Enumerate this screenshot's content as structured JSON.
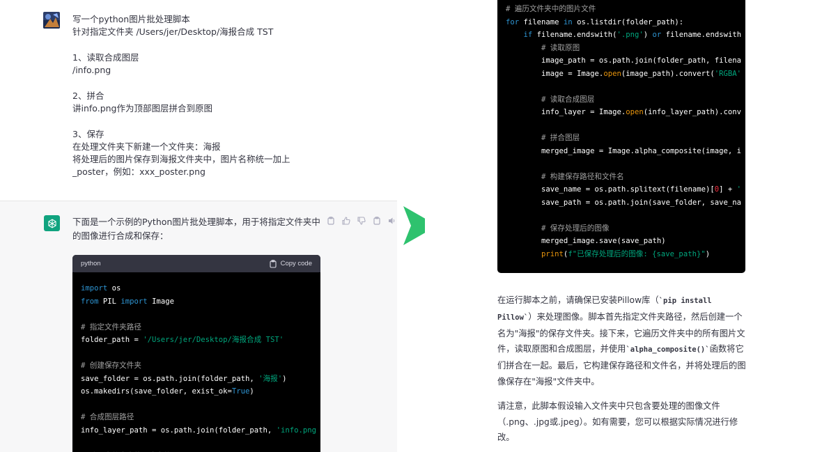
{
  "user_message": {
    "lines": [
      "写一个python图片批处理脚本",
      "针对指定文件夹 /Users/jer/Desktop/海报合成 TST",
      "",
      "1、读取合成图层",
      "/info.png",
      "",
      "2、拼合",
      "讲info.png作为顶部图层拼合到原图",
      "",
      "3、保存",
      "在处理文件夹下新建一个文件夹：海报",
      "将处理后的图片保存到海报文件夹中，图片名称统一加上",
      "_poster，例如：xxx_poster.png"
    ]
  },
  "assistant_message": {
    "intro": "下面是一个示例的Python图片批处理脚本，用于将指定文件夹中的图像进行合成和保存：",
    "code_language": "python",
    "copy_label": "Copy code"
  },
  "code_left_lines": [
    [
      {
        "t": "import",
        "c": "kw"
      },
      {
        "t": " os"
      }
    ],
    [
      {
        "t": "from",
        "c": "kw"
      },
      {
        "t": " PIL "
      },
      {
        "t": "import",
        "c": "kw"
      },
      {
        "t": " Image"
      }
    ],
    [],
    [
      {
        "t": "# 指定文件夹路径",
        "c": "cm"
      }
    ],
    [
      {
        "t": "folder_path = "
      },
      {
        "t": "'/Users/jer/Desktop/海报合成 TST'",
        "c": "str"
      }
    ],
    [],
    [
      {
        "t": "# 创建保存文件夹",
        "c": "cm"
      }
    ],
    [
      {
        "t": "save_folder = os.path.join(folder_path, "
      },
      {
        "t": "'海报'",
        "c": "str"
      },
      {
        "t": ")"
      }
    ],
    [
      {
        "t": "os.makedirs(save_folder, exist_ok="
      },
      {
        "t": "True",
        "c": "kw"
      },
      {
        "t": ")"
      }
    ],
    [],
    [
      {
        "t": "# 合成图层路径",
        "c": "cm"
      }
    ],
    [
      {
        "t": "info_layer_path = os.path.join(folder_path, "
      },
      {
        "t": "'info.png",
        "c": "str"
      }
    ],
    [],
    [
      {
        "t": "# 遍历文件夹中的图片文件",
        "c": "cm"
      }
    ]
  ],
  "code_right_lines": [
    [
      {
        "t": "# 遍历文件夹中的图片文件",
        "c": "cm"
      }
    ],
    [
      {
        "t": "for",
        "c": "kw"
      },
      {
        "t": " filename "
      },
      {
        "t": "in",
        "c": "kw"
      },
      {
        "t": " os.listdir(folder_path):"
      }
    ],
    [
      {
        "t": "    "
      },
      {
        "t": "if",
        "c": "kw"
      },
      {
        "t": " filename.endswith("
      },
      {
        "t": "'.png'",
        "c": "str"
      },
      {
        "t": ") "
      },
      {
        "t": "or",
        "c": "kw"
      },
      {
        "t": " filename.endswith"
      }
    ],
    [
      {
        "t": "        "
      },
      {
        "t": "# 读取原图",
        "c": "cm"
      }
    ],
    [
      {
        "t": "        image_path = os.path.join(folder_path, filena"
      }
    ],
    [
      {
        "t": "        image = Image."
      },
      {
        "t": "open",
        "c": "builtin"
      },
      {
        "t": "(image_path).convert("
      },
      {
        "t": "'RGBA'",
        "c": "str"
      }
    ],
    [],
    [
      {
        "t": "        "
      },
      {
        "t": "# 读取合成图层",
        "c": "cm"
      }
    ],
    [
      {
        "t": "        info_layer = Image."
      },
      {
        "t": "open",
        "c": "builtin"
      },
      {
        "t": "(info_layer_path).conv"
      }
    ],
    [],
    [
      {
        "t": "        "
      },
      {
        "t": "# 拼合图层",
        "c": "cm"
      }
    ],
    [
      {
        "t": "        merged_image = Image.alpha_composite(image, i"
      }
    ],
    [],
    [
      {
        "t": "        "
      },
      {
        "t": "# 构建保存路径和文件名",
        "c": "cm"
      }
    ],
    [
      {
        "t": "        save_name = os.path.splitext(filename)["
      },
      {
        "t": "0",
        "c": "org"
      },
      {
        "t": "] + "
      },
      {
        "t": "'",
        "c": "str"
      }
    ],
    [
      {
        "t": "        save_path = os.path.join(save_folder, save_na"
      }
    ],
    [],
    [
      {
        "t": "        "
      },
      {
        "t": "# 保存处理后的图像",
        "c": "cm"
      }
    ],
    [
      {
        "t": "        merged_image.save(save_path)"
      }
    ],
    [
      {
        "t": "        "
      },
      {
        "t": "print",
        "c": "builtin"
      },
      {
        "t": "(",
        "c": ""
      },
      {
        "t": "f\"已保存处理后的图像: {save_path}\"",
        "c": "str"
      },
      {
        "t": ")"
      }
    ]
  ],
  "right_text": {
    "p1_a": "在运行脚本之前，请确保已安装Pillow库（",
    "p1_code1": "`pip install Pillow`",
    "p1_b": "）来处理图像。脚本首先指定文件夹路径，然后创建一个名为\"海报\"的保存文件夹。接下来，它遍历文件夹中的所有图片文件，读取原图和合成图层，并使用",
    "p1_code2": "`alpha_composite()`",
    "p1_c": "函数将它们拼合在一起。最后，它构建保存路径和文件名，并将处理后的图像保存在\"海报\"文件夹中。",
    "p2": "请注意，此脚本假设输入文件夹中只包含要处理的图像文件（.png、.jpg或.jpeg）。如有需要，您可以根据实际情况进行修改。"
  },
  "colors": {
    "accent_green": "#10a37f",
    "arrow_green": "#2ec26e",
    "code_bg": "#000000",
    "code_header": "#343541"
  }
}
